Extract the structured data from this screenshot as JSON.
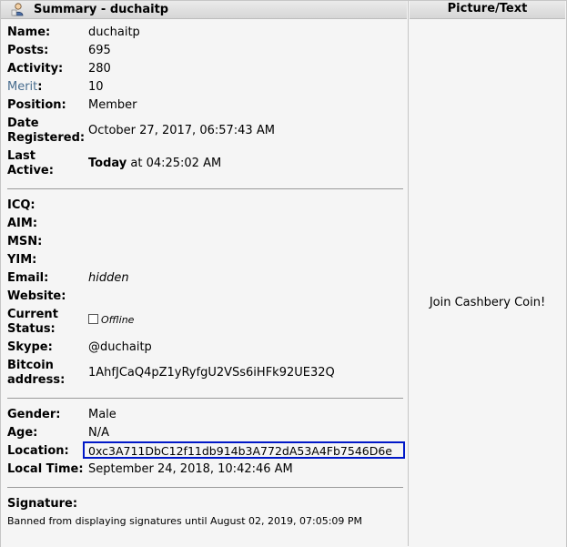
{
  "header": {
    "summary_title": "Summary - duchaitp",
    "picture_title": "Picture/Text"
  },
  "profile": {
    "name_label": "Name:",
    "name": "duchaitp",
    "posts_label": "Posts:",
    "posts": "695",
    "activity_label": "Activity:",
    "activity": "280",
    "merit_label": "Merit",
    "merit_colon": ":",
    "merit": "10",
    "position_label": "Position:",
    "position": "Member",
    "date_registered_label_1": "Date",
    "date_registered_label_2": "Registered:",
    "date_registered": "October 27, 2017, 06:57:43 AM",
    "last_active_label_1": "Last",
    "last_active_label_2": "Active:",
    "last_active_bold": "Today",
    "last_active_rest": " at 04:25:02 AM"
  },
  "contact": {
    "icq_label": "ICQ:",
    "aim_label": "AIM:",
    "msn_label": "MSN:",
    "yim_label": "YIM:",
    "email_label": "Email:",
    "email": "hidden",
    "website_label": "Website:",
    "status_label_1": "Current",
    "status_label_2": "Status:",
    "status": "Offline",
    "skype_label": "Skype:",
    "skype": "@duchaitp",
    "bitcoin_label_1": "Bitcoin",
    "bitcoin_label_2": "address:",
    "bitcoin": "1AhfJCaQ4pZ1yRyfgU2VSs6iHFk92UE32Q"
  },
  "personal": {
    "gender_label": "Gender:",
    "gender": "Male",
    "age_label": "Age:",
    "age": "N/A",
    "location_label": "Location:",
    "location": "0xc3A711DbC12f11db914b3A772dA53A4Fb7546D6e",
    "local_time_label": "Local Time:",
    "local_time": "September 24, 2018, 10:42:46 AM"
  },
  "signature": {
    "label": "Signature:",
    "text": "Banned from displaying signatures until August 02, 2019, 07:05:09 PM"
  },
  "picture_text": "Join Cashbery Coin!",
  "icons": {
    "user": "user-icon",
    "status": "offline-checkbox"
  },
  "colors": {
    "merit_link": "#476c8e",
    "location_highlight": "#0018c8"
  }
}
